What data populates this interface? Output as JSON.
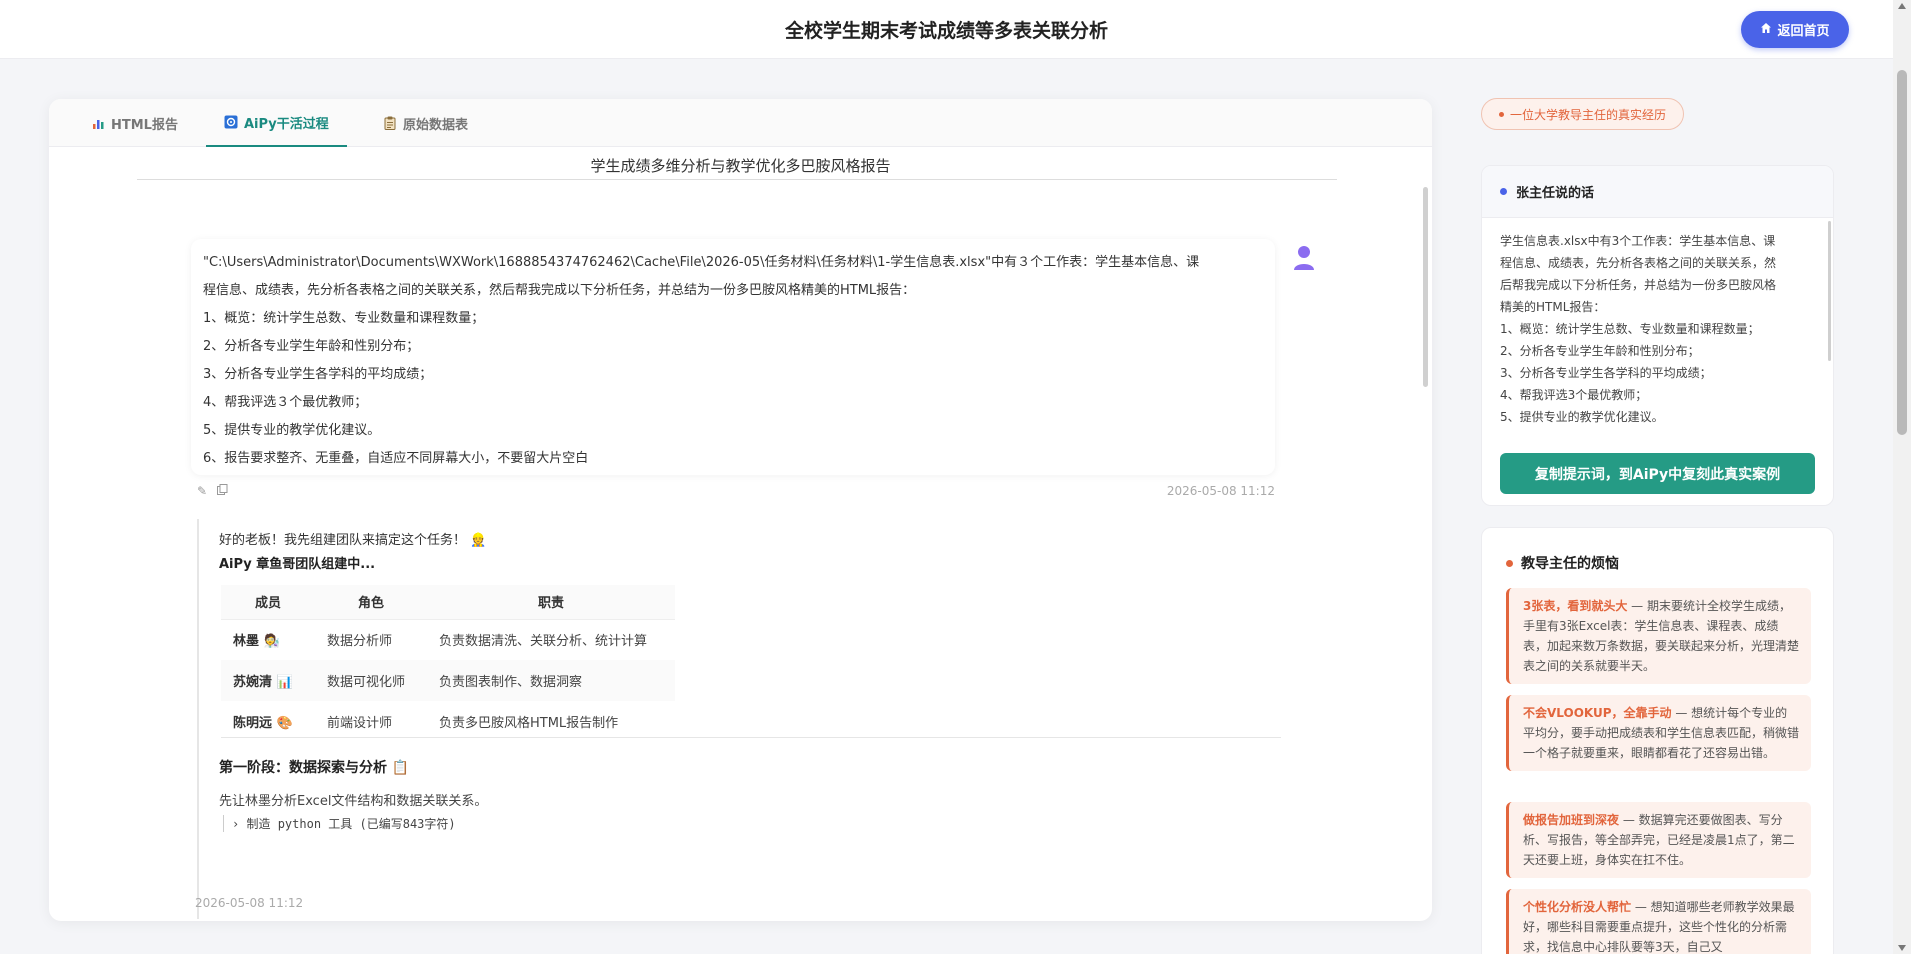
{
  "header": {
    "title": "全校学生期末考试成绩等多表关联分析",
    "home_label": "返回首页"
  },
  "tabs": [
    {
      "label": "HTML报告",
      "icon": "bar-chart-icon",
      "active": false
    },
    {
      "label": "AiPy干活过程",
      "icon": "robot-icon",
      "active": true
    },
    {
      "label": "原始数据表",
      "icon": "clipboard-icon",
      "active": false
    }
  ],
  "report": {
    "title": "学生成绩多维分析与教学优化多巴胺风格报告"
  },
  "user_message": {
    "lines": [
      "\"C:\\Users\\Administrator\\Documents\\WXWork\\1688854374762462\\Cache\\File\\2026-05\\任务材料\\任务材料\\1-学生信息表.xlsx\"中有３个工作表：学生基本信息、课",
      "程信息、成绩表，先分析各表格之间的关联关系，然后帮我完成以下分析任务，并总结为一份多巴胺风格精美的HTML报告：",
      "1、概览：统计学生总数、专业数量和课程数量；",
      "2、分析各专业学生年龄和性别分布；",
      "3、分析各专业学生各学科的平均成绩；",
      "4、帮我评选３个最优教师；",
      "5、提供专业的教学优化建议。",
      "6、报告要求整齐、无重叠，自适应不同屏幕大小，不要留大片空白"
    ],
    "timestamp": "2026-05-08 11:12",
    "avatar_icon": "user-avatar-icon"
  },
  "ai_message": {
    "greeting": "好的老板！我先组建团队来搞定这个任务！",
    "greeting_emoji": "👷",
    "team_title": "AiPy 章鱼哥团队组建中...",
    "table_headers": [
      "成员",
      "角色",
      "职责"
    ],
    "table_rows": [
      {
        "name": "林墨",
        "emoji": "🧑‍🔬",
        "role": "数据分析师",
        "duty": "负责数据清洗、关联分析、统计计算"
      },
      {
        "name": "苏婉清",
        "emoji": "📊",
        "role": "数据可视化师",
        "duty": "负责图表制作、数据洞察"
      },
      {
        "name": "陈明远",
        "emoji": "🎨",
        "role": "前端设计师",
        "duty": "负责多巴胺风格HTML报告制作"
      }
    ],
    "stage_title": "第一阶段：数据探索与分析",
    "stage_emoji": "📋",
    "stage_desc": "先让林墨分析Excel文件结构和数据关联关系。",
    "tool_line": "制造 python 工具 (已编写843字符)",
    "timestamp": "2026-05-08 11:12"
  },
  "sidebar": {
    "story_badge": "一位大学教导主任的真实经历",
    "quote_card": {
      "title": "张主任说的话",
      "lines": [
        "学生信息表.xlsx中有3个工作表：学生基本信息、课",
        "程信息、成绩表，先分析各表格之间的关联关系，然",
        "后帮我完成以下分析任务，并总结为一份多巴胺风格",
        "精美的HTML报告：",
        "1、概览：统计学生总数、专业数量和课程数量；",
        "2、分析各专业学生年龄和性别分布；",
        "3、分析各专业学生各学科的平均成绩；",
        "4、帮我评选3个最优教师；",
        "5、提供专业的教学优化建议。"
      ],
      "button_label": "复制提示词，到AiPy中复刻此真实案例"
    },
    "pain_card": {
      "title": "教导主任的烦恼",
      "items": [
        {
          "title": "3张表，看到就头大",
          "text": " — 期末要统计全校学生成绩，手里有3张Excel表：学生信息表、课程表、成绩表，加起来数万条数据，要关联起来分析，光理清楚表之间的关系就要半天。"
        },
        {
          "title": "不会VLOOKUP，全靠手动",
          "text": " — 想统计每个专业的平均分，要手动把成绩表和学生信息表匹配，稍微错一个格子就要重来，眼睛都看花了还容易出错。"
        },
        {
          "title": "做报告加班到深夜",
          "text": " — 数据算完还要做图表、写分析、写报告，等全部弄完，已经是凌晨1点了，第二天还要上班，身体实在扛不住。"
        },
        {
          "title": "个性化分析没人帮忙",
          "text": " — 想知道哪些老师教学效果最好，哪些科目需要重点提升，这些个性化的分析需求，找信息中心排队要等3天，自己又"
        }
      ]
    }
  },
  "colors": {
    "accent_blue": "#4a63e8",
    "accent_teal": "#1a8a80",
    "button_green": "#259b85",
    "accent_orange": "#e2653c"
  }
}
